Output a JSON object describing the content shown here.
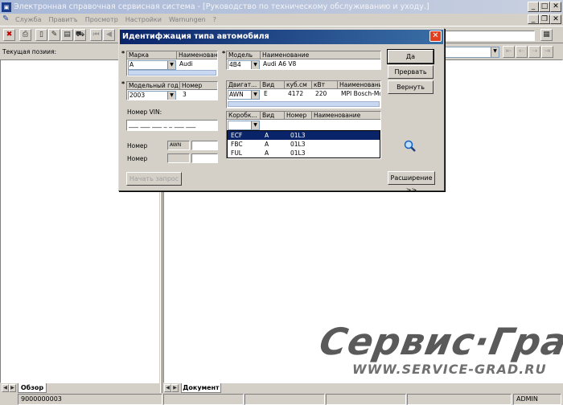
{
  "window": {
    "icon": "app-icon",
    "title": "Электронная справочная сервисная система - [Руководство по техническому обслуживанию и уходу.]",
    "min": "_",
    "max": "□",
    "close": "✕"
  },
  "menu": [
    "Служба",
    "Правитъ",
    "Просмотр",
    "Настройки",
    "Warnungen",
    "?"
  ],
  "left_pane": {
    "label": "Текущая позиия:"
  },
  "left_tab": "Обзор",
  "right_tab": "Документ",
  "status": {
    "left": "9000000003",
    "user": "ADMIN"
  },
  "dialog": {
    "title": "Идентифжация типа автомобиля",
    "close": "✕",
    "buttons": {
      "ok": "Да",
      "abort": "Прервать",
      "back": "Вернуть",
      "start": "Начать запрос",
      "extend": "Расширение >>"
    },
    "brand": {
      "headers": [
        "Марка",
        "Наименование"
      ],
      "value": "A",
      "name": "Audi"
    },
    "year": {
      "headers": [
        "Модельный год",
        "Номер"
      ],
      "value": "2003",
      "number": "3"
    },
    "model": {
      "headers": [
        "Модель",
        "Наименование"
      ],
      "value": "4B4",
      "name": "Audi A6 V8"
    },
    "engine": {
      "headers": [
        "Двигат...",
        "Вид",
        "куб.см",
        "кВт",
        "Наименование"
      ],
      "row": [
        "AWN",
        "E",
        "4172",
        "220",
        "MPI Bosch-Mot"
      ]
    },
    "gearbox": {
      "headers": [
        "Коробк...",
        "Вид",
        "Номер",
        "Наименование"
      ],
      "rows": [
        [
          "ECF",
          "A",
          "01L3",
          ""
        ],
        [
          "FBC",
          "A",
          "01L3",
          ""
        ],
        [
          "FUL",
          "A",
          "01L3",
          ""
        ]
      ]
    },
    "vin_label": "Номер VIN:",
    "vin_dash": "___ ___ ___ _ _ ___ ___",
    "number_label": "Номер",
    "number_label2": "Номер",
    "number_value": "AWN"
  },
  "watermark": {
    "brand": "Сервис·Град",
    "url": "WWW.SERVICE-GRAD.RU"
  }
}
